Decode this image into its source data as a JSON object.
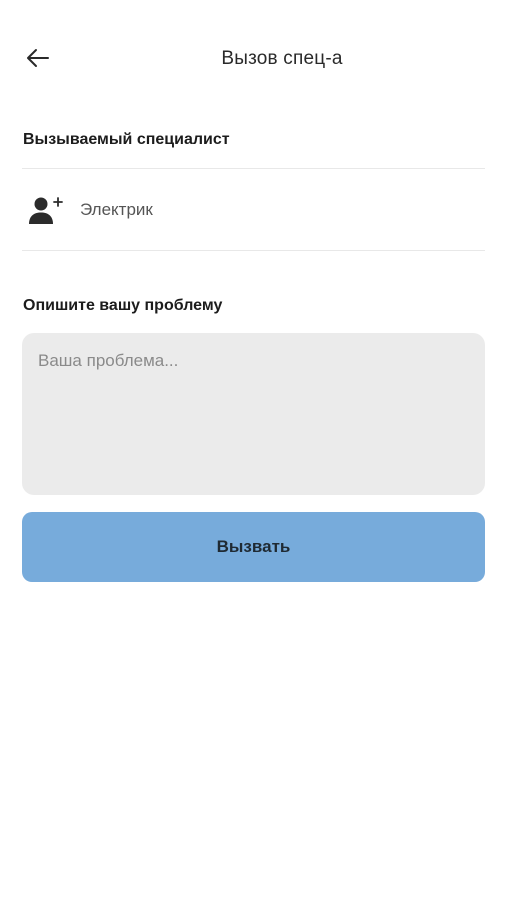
{
  "header": {
    "title": "Вызов спец-а",
    "back_icon": "arrow-left-icon"
  },
  "specialist_section": {
    "label": "Вызываемый специалист",
    "icon": "person-add-icon",
    "selected": "Электрик"
  },
  "problem_section": {
    "label": "Опишите вашу проблему",
    "placeholder": "Ваша проблема...",
    "value": ""
  },
  "actions": {
    "call_label": "Вызвать"
  },
  "colors": {
    "button_bg": "#77abdb",
    "input_bg": "#ebebeb",
    "divider": "#e8e8e8"
  }
}
